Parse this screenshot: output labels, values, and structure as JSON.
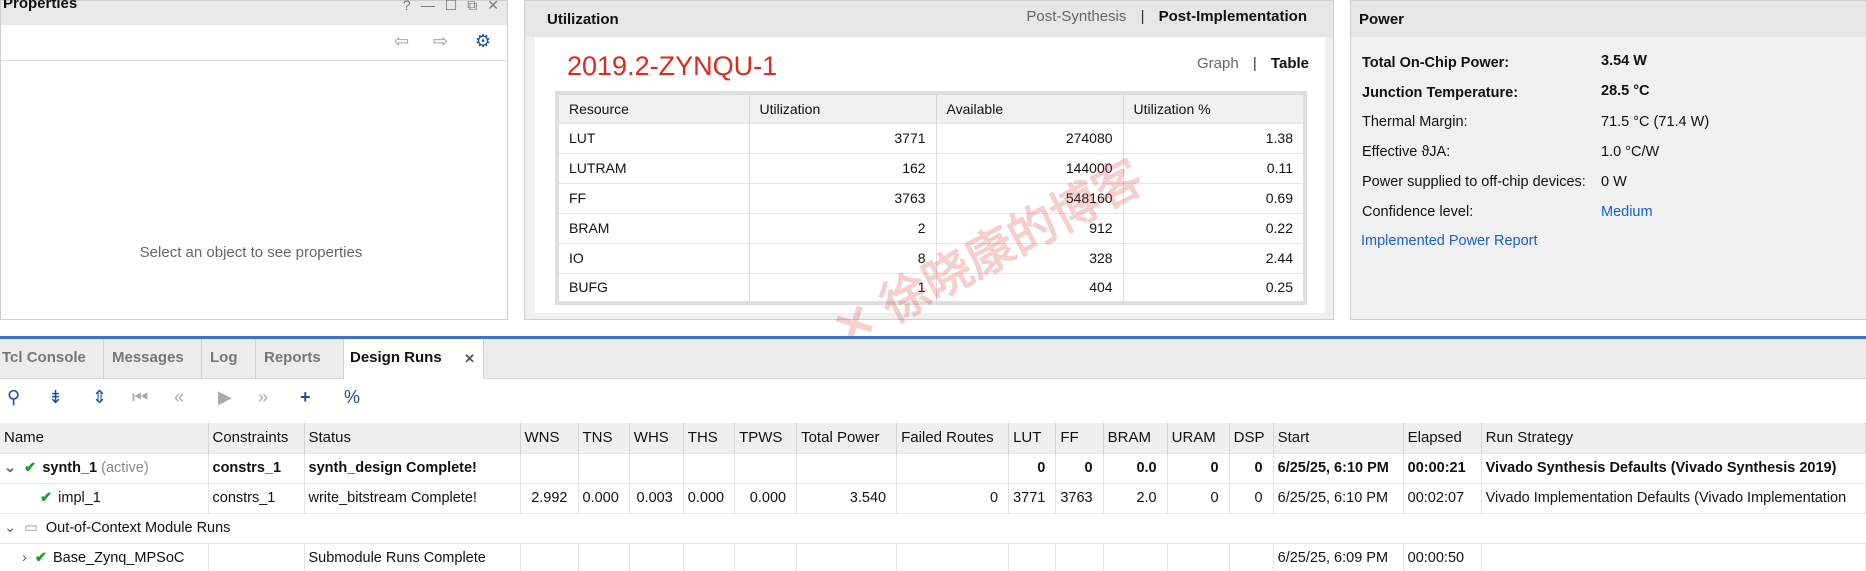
{
  "properties": {
    "title": "Properties",
    "empty_text": "Select an object to see properties"
  },
  "utilization": {
    "title": "Utilization",
    "mode_post_synth": "Post-Synthesis",
    "mode_post_impl": "Post-Implementation",
    "part": "2019.2-ZYNQU-1",
    "view_graph": "Graph",
    "view_table": "Table",
    "columns": [
      "Resource",
      "Utilization",
      "Available",
      "Utilization %"
    ],
    "rows": [
      [
        "LUT",
        "3771",
        "274080",
        "1.38"
      ],
      [
        "LUTRAM",
        "162",
        "144000",
        "0.11"
      ],
      [
        "FF",
        "3763",
        "548160",
        "0.69"
      ],
      [
        "BRAM",
        "2",
        "912",
        "0.22"
      ],
      [
        "IO",
        "8",
        "328",
        "2.44"
      ],
      [
        "BUFG",
        "1",
        "404",
        "0.25"
      ]
    ]
  },
  "power": {
    "title": "Power",
    "items": [
      {
        "label": "Total On-Chip Power:",
        "value": "3.54 W",
        "bold": true
      },
      {
        "label": "Junction Temperature:",
        "value": "28.5 °C",
        "bold": true
      },
      {
        "label": "Thermal Margin:",
        "value": "71.5 °C (71.4 W)"
      },
      {
        "label": "Effective ϑJA:",
        "value": "1.0 °C/W"
      },
      {
        "label": "Power supplied to off-chip devices:",
        "value": "0 W"
      },
      {
        "label": "Confidence level:",
        "value": "Medium"
      }
    ],
    "report_link": "Implemented Power Report"
  },
  "bottom_tabs": [
    "Tcl Console",
    "Messages",
    "Log",
    "Reports",
    "Design Runs"
  ],
  "runs": {
    "columns": [
      "Name",
      "Constraints",
      "Status",
      "WNS",
      "TNS",
      "WHS",
      "THS",
      "TPWS",
      "Total Power",
      "Failed Routes",
      "LUT",
      "FF",
      "BRAM",
      "URAM",
      "DSP",
      "Start",
      "Elapsed",
      "Run Strategy"
    ],
    "synth": {
      "name": "synth_1",
      "tag": "(active)",
      "constraints": "constrs_1",
      "status": "synth_design Complete!",
      "lut": "0",
      "ff": "0",
      "bram": "0.0",
      "uram": "0",
      "dsp": "0",
      "start": "6/25/25, 6:10 PM",
      "elapsed": "00:00:21",
      "strategy": "Vivado Synthesis Defaults (Vivado Synthesis 2019)"
    },
    "impl": {
      "name": "impl_1",
      "constraints": "constrs_1",
      "status": "write_bitstream Complete!",
      "wns": "2.992",
      "tns": "0.000",
      "whs": "0.003",
      "ths": "0.000",
      "tpws": "0.000",
      "power": "3.540",
      "failed": "0",
      "lut": "3771",
      "ff": "3763",
      "bram": "2.0",
      "uram": "0",
      "dsp": "0",
      "start": "6/25/25, 6:10 PM",
      "elapsed": "00:02:07",
      "strategy": "Vivado Implementation Defaults (Vivado Implementation"
    },
    "ooc_group": "Out-of-Context Module Runs",
    "ooc": {
      "name": "Base_Zynq_MPSoC",
      "status": "Submodule Runs Complete",
      "start": "6/25/25, 6:09 PM",
      "elapsed": "00:00:50"
    }
  },
  "colors": {
    "accent": "#3c74c8",
    "part": "#e0281e",
    "link": "#1a5fcf",
    "check": "#17a32a"
  }
}
